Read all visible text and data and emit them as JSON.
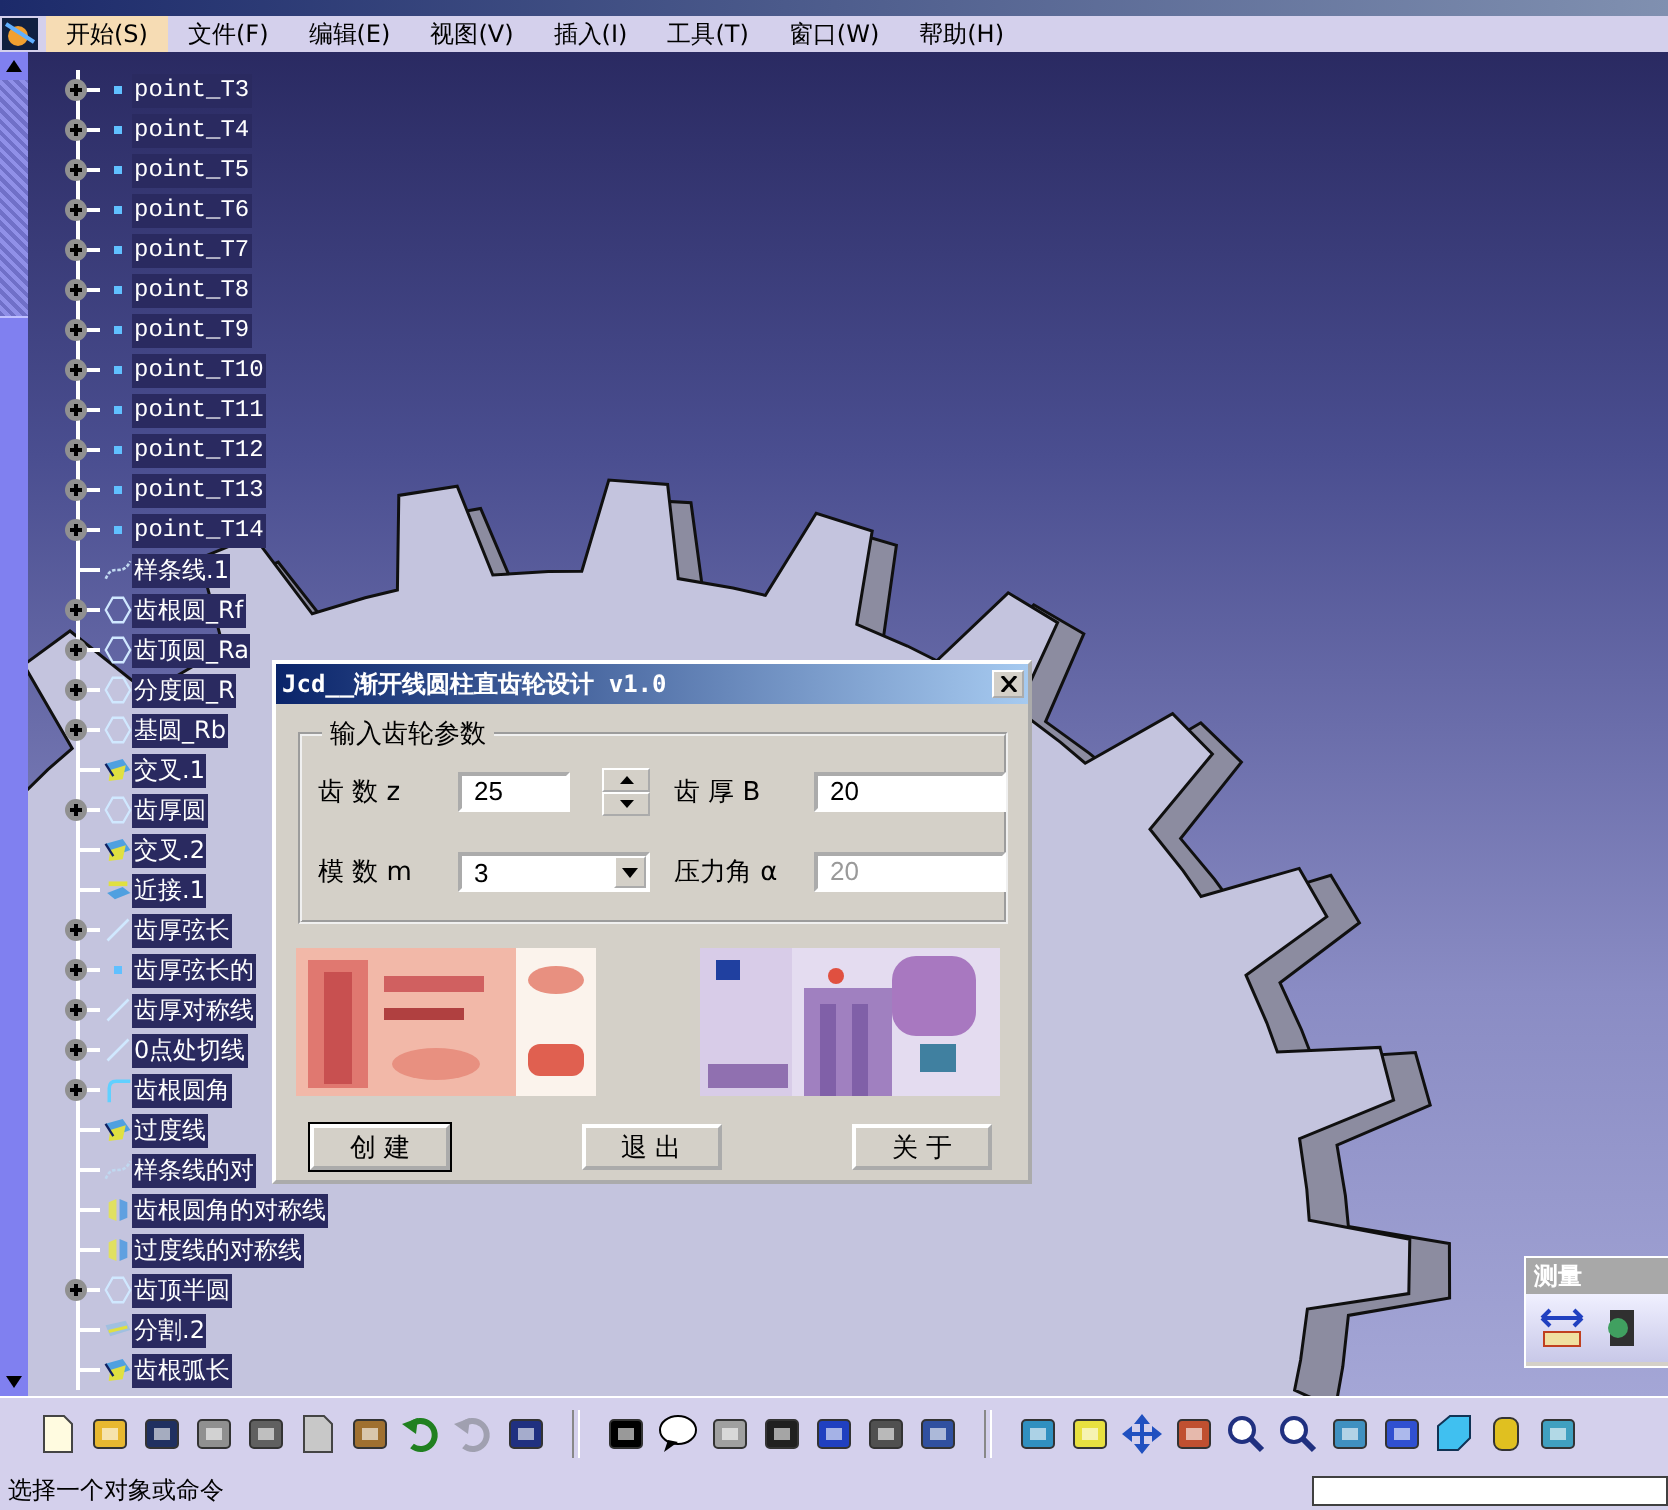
{
  "menu": [
    {
      "label": "开始(S)",
      "selected": true
    },
    {
      "label": "文件(F)",
      "selected": false
    },
    {
      "label": "编辑(E)",
      "selected": false
    },
    {
      "label": "视图(V)",
      "selected": false
    },
    {
      "label": "插入(I)",
      "selected": false
    },
    {
      "label": "工具(T)",
      "selected": false
    },
    {
      "label": "窗口(W)",
      "selected": false
    },
    {
      "label": "帮助(H)",
      "selected": false
    }
  ],
  "tree": {
    "items": [
      {
        "label": "point_T3",
        "kind": "point",
        "collapsed": true
      },
      {
        "label": "point_T4",
        "kind": "point",
        "collapsed": true
      },
      {
        "label": "point_T5",
        "kind": "point",
        "collapsed": true
      },
      {
        "label": "point_T6",
        "kind": "point",
        "collapsed": true
      },
      {
        "label": "point_T7",
        "kind": "point",
        "collapsed": true
      },
      {
        "label": "point_T8",
        "kind": "point",
        "collapsed": true
      },
      {
        "label": "point_T9",
        "kind": "point",
        "collapsed": true
      },
      {
        "label": "point_T10",
        "kind": "point",
        "collapsed": true
      },
      {
        "label": "point_T11",
        "kind": "point",
        "collapsed": true
      },
      {
        "label": "point_T12",
        "kind": "point",
        "collapsed": true
      },
      {
        "label": "point_T13",
        "kind": "point",
        "collapsed": true
      },
      {
        "label": "point_T14",
        "kind": "point",
        "collapsed": true
      },
      {
        "label": "样条线.1",
        "kind": "spline",
        "collapsed": false
      },
      {
        "label": "齿根圆_Rf",
        "kind": "circle",
        "collapsed": true
      },
      {
        "label": "齿顶圆_Ra",
        "kind": "circle",
        "collapsed": true
      },
      {
        "label": "分度圆_R",
        "kind": "circle",
        "collapsed": true
      },
      {
        "label": "基圆_Rb",
        "kind": "circle",
        "collapsed": true
      },
      {
        "label": "交叉.1",
        "kind": "intersect",
        "collapsed": false
      },
      {
        "label": "齿厚圆",
        "kind": "circle",
        "collapsed": true
      },
      {
        "label": "交叉.2",
        "kind": "intersect",
        "collapsed": false
      },
      {
        "label": "近接.1",
        "kind": "near",
        "collapsed": false
      },
      {
        "label": "齿厚弦长",
        "kind": "line",
        "collapsed": true
      },
      {
        "label": "齿厚弦长的",
        "kind": "point",
        "collapsed": true
      },
      {
        "label": "齿厚对称线",
        "kind": "line",
        "collapsed": true
      },
      {
        "label": "0点处切线",
        "kind": "line",
        "collapsed": true
      },
      {
        "label": "齿根圆角",
        "kind": "corner",
        "collapsed": true
      },
      {
        "label": "过度线",
        "kind": "intersect",
        "collapsed": false
      },
      {
        "label": "样条线的对",
        "kind": "spline",
        "collapsed": false
      },
      {
        "label": "齿根圆角的对称线",
        "kind": "symmetry",
        "collapsed": false
      },
      {
        "label": "过度线的对称线",
        "kind": "symmetry",
        "collapsed": false
      },
      {
        "label": "齿顶半圆",
        "kind": "circle",
        "collapsed": true
      },
      {
        "label": "分割.2",
        "kind": "split",
        "collapsed": false
      },
      {
        "label": "齿根弧长",
        "kind": "intersect",
        "collapsed": false
      }
    ]
  },
  "dialog": {
    "title": "Jcd__渐开线圆柱直齿轮设计 v1.0",
    "group_title": "输入齿轮参数",
    "fields": [
      {
        "label": "齿 数 z",
        "value": "25",
        "kind": "spin",
        "disabled": false
      },
      {
        "label": "齿 厚 B",
        "value": "20",
        "kind": "text",
        "disabled": false
      },
      {
        "label": "模 数 m",
        "value": "3",
        "kind": "dropdown",
        "disabled": false
      },
      {
        "label": "压力角 α",
        "value": "20",
        "kind": "text",
        "disabled": true
      }
    ],
    "buttons": [
      {
        "label": "创 建",
        "default": true
      },
      {
        "label": "退 出",
        "default": false
      },
      {
        "label": "关 于",
        "default": false
      }
    ]
  },
  "measure_panel": {
    "title": "测量"
  },
  "status_bar": {
    "text": "选择一个对象或命令"
  }
}
